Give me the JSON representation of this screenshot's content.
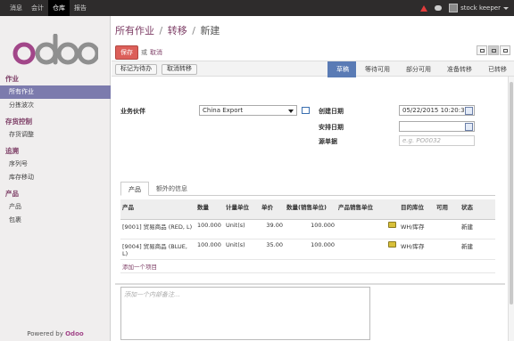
{
  "topbar": {
    "menu": [
      "消息",
      "会计",
      "仓库",
      "报告"
    ],
    "active_index": 2,
    "user": "stock keeper"
  },
  "sidebar": {
    "sections": [
      {
        "title": "作业",
        "items": [
          "所有作业",
          "分拣波次"
        ]
      },
      {
        "title": "存货控制",
        "items": [
          "存货调整"
        ]
      },
      {
        "title": "追溯",
        "items": [
          "序列号",
          "库存移动"
        ]
      },
      {
        "title": "产品",
        "items": [
          "产品",
          "包裹"
        ]
      }
    ],
    "active_item": "所有作业",
    "powered_prefix": "Powered by",
    "powered_brand": "Odoo"
  },
  "breadcrumb": {
    "level1": "所有作业",
    "level2": "转移",
    "current": "新建"
  },
  "toolbar": {
    "save_label": "保存",
    "or_label": "或",
    "discard_label": "取消"
  },
  "statusbar": {
    "buttons": [
      "标记为待办",
      "取消转移"
    ],
    "stages": [
      "草稿",
      "等待可用",
      "部分可用",
      "准备转移",
      "已转移"
    ],
    "current_stage": "草稿"
  },
  "form": {
    "partner_label": "业务伙伴",
    "partner_value": "China Export",
    "date_label": "创建日期",
    "date_value": "05/22/2015 10:20:33",
    "scheduled_label": "安排日期",
    "scheduled_value": "",
    "origin_label": "源单据",
    "origin_placeholder": "e.g. PO0032"
  },
  "tabs": [
    "产品",
    "额外的信息"
  ],
  "table": {
    "headers": [
      "产品",
      "数量",
      "计量单位",
      "单价",
      "数量(销售单位)",
      "产品销售单位",
      "",
      "目的库位",
      "可用",
      "状态"
    ],
    "rows": [
      [
        "[9001] 贸易商品 (RED, L)",
        "100.000",
        "Unit(s)",
        "39.00",
        "100.000",
        "",
        "",
        "WH/库存",
        "",
        "新建"
      ],
      [
        "[9004] 贸易商品 (BLUE, L)",
        "100.000",
        "Unit(s)",
        "35.00",
        "100.000",
        "",
        "",
        "WH/库存",
        "",
        "新建"
      ]
    ],
    "add_line": "添加一个项目"
  },
  "note_placeholder": "添加一个内部备注..."
}
